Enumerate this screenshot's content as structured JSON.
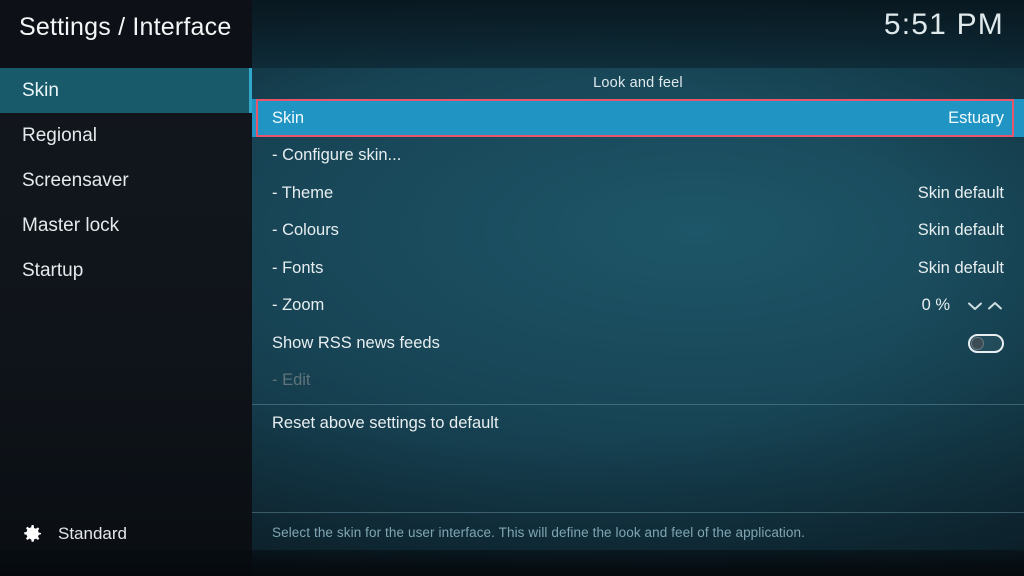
{
  "header": {
    "title": "Settings / Interface",
    "clock": "5:51 PM"
  },
  "sidebar": {
    "items": [
      {
        "label": "Skin",
        "selected": true
      },
      {
        "label": "Regional",
        "selected": false
      },
      {
        "label": "Screensaver",
        "selected": false
      },
      {
        "label": "Master lock",
        "selected": false
      },
      {
        "label": "Startup",
        "selected": false
      }
    ],
    "level": {
      "icon": "gear-icon",
      "label": "Standard"
    }
  },
  "main": {
    "section_title": "Look and feel",
    "settings": [
      {
        "label": "Skin",
        "value": "Estuary",
        "type": "select",
        "selected": true,
        "disabled": false
      },
      {
        "label": "- Configure skin...",
        "value": "",
        "type": "action",
        "selected": false,
        "disabled": false
      },
      {
        "label": "- Theme",
        "value": "Skin default",
        "type": "select",
        "selected": false,
        "disabled": false
      },
      {
        "label": "- Colours",
        "value": "Skin default",
        "type": "select",
        "selected": false,
        "disabled": false
      },
      {
        "label": "- Fonts",
        "value": "Skin default",
        "type": "select",
        "selected": false,
        "disabled": false
      },
      {
        "label": "- Zoom",
        "value": "0 %",
        "type": "spinner",
        "selected": false,
        "disabled": false
      },
      {
        "label": "Show RSS news feeds",
        "value": "off",
        "type": "toggle",
        "selected": false,
        "disabled": false
      },
      {
        "label": "- Edit",
        "value": "",
        "type": "action",
        "selected": false,
        "disabled": true
      }
    ],
    "reset_label": "Reset above settings to default",
    "help_text": "Select the skin for the user interface. This will define the look and feel of the application."
  },
  "colors": {
    "selected_row": "#2095c4",
    "sidebar_selected": "#18596a",
    "annotation_outline": "#e8566d",
    "help_text": "#7fa6b3"
  }
}
